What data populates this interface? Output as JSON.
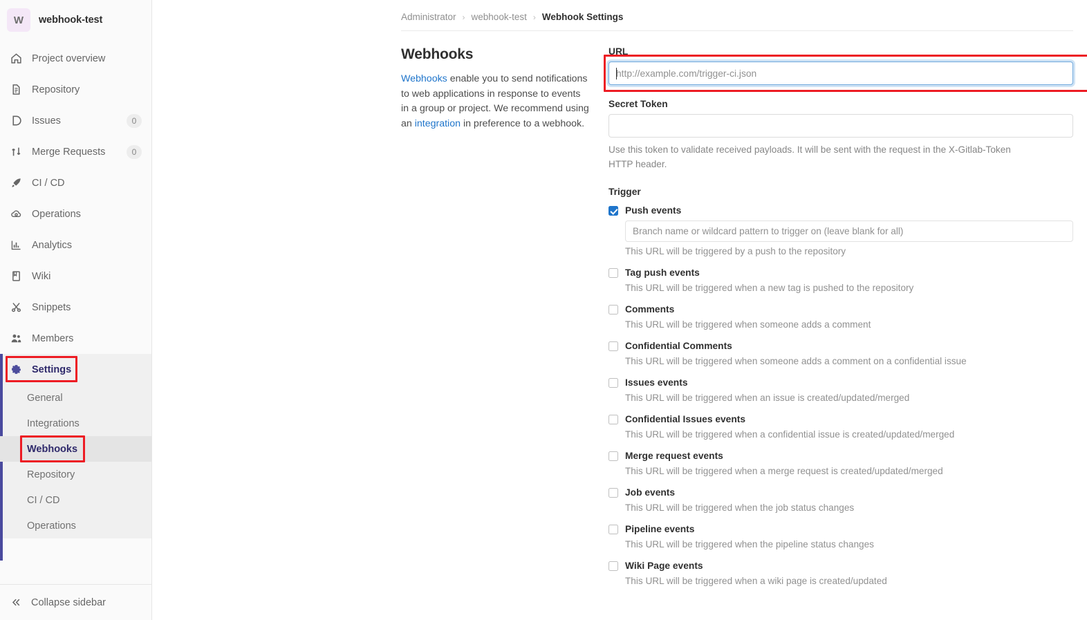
{
  "sidebar": {
    "project": {
      "avatar_letter": "W",
      "name": "webhook-test",
      "avatar_color": "#f4e7f7"
    },
    "items": [
      {
        "label": "Project overview",
        "icon": "home-icon",
        "badge": null
      },
      {
        "label": "Repository",
        "icon": "document-icon",
        "badge": null
      },
      {
        "label": "Issues",
        "icon": "issues-icon",
        "badge": "0"
      },
      {
        "label": "Merge Requests",
        "icon": "merge-request-icon",
        "badge": "0"
      },
      {
        "label": "CI / CD",
        "icon": "rocket-icon",
        "badge": null
      },
      {
        "label": "Operations",
        "icon": "cloud-gear-icon",
        "badge": null
      },
      {
        "label": "Analytics",
        "icon": "chart-icon",
        "badge": null
      },
      {
        "label": "Wiki",
        "icon": "book-icon",
        "badge": null
      },
      {
        "label": "Snippets",
        "icon": "scissors-icon",
        "badge": null
      },
      {
        "label": "Members",
        "icon": "users-icon",
        "badge": null
      },
      {
        "label": "Settings",
        "icon": "gear-icon",
        "badge": null,
        "active": true
      }
    ],
    "subitems": [
      {
        "label": "General"
      },
      {
        "label": "Integrations"
      },
      {
        "label": "Webhooks",
        "current": true
      },
      {
        "label": "Repository"
      },
      {
        "label": "CI / CD"
      },
      {
        "label": "Operations"
      }
    ],
    "collapse": {
      "label": "Collapse sidebar",
      "icon": "double-chevron-left-icon"
    },
    "active_color": "#2f2a6b",
    "rail_color": "#4a4a9e"
  },
  "breadcrumb": {
    "items": [
      "Administrator",
      "webhook-test",
      "Webhook Settings"
    ],
    "separator": "›"
  },
  "description": {
    "title": "Webhooks",
    "link1": "Webhooks",
    "text1": " enable you to send notifications to web applications in response to events in a group or project. We recommend using an ",
    "link2": "integration",
    "text2": " in preference to a webhook."
  },
  "form": {
    "url": {
      "label": "URL",
      "placeholder": "http://example.com/trigger-ci.json",
      "value": "",
      "focused": true,
      "highlight_color": "#ed1c24"
    },
    "secret_token": {
      "label": "Secret Token",
      "placeholder": "",
      "value": "",
      "help": "Use this token to validate received payloads. It will be sent with the request in the X-Gitlab-Token HTTP header."
    },
    "trigger_title": "Trigger",
    "triggers": [
      {
        "name": "Push events",
        "checked": true,
        "branch_input_placeholder": "Branch name or wildcard pattern to trigger on (leave blank for all)",
        "branch_input_value": "",
        "desc": "This URL will be triggered by a push to the repository"
      },
      {
        "name": "Tag push events",
        "checked": false,
        "desc": "This URL will be triggered when a new tag is pushed to the repository"
      },
      {
        "name": "Comments",
        "checked": false,
        "desc": "This URL will be triggered when someone adds a comment"
      },
      {
        "name": "Confidential Comments",
        "checked": false,
        "desc": "This URL will be triggered when someone adds a comment on a confidential issue"
      },
      {
        "name": "Issues events",
        "checked": false,
        "desc": "This URL will be triggered when an issue is created/updated/merged"
      },
      {
        "name": "Confidential Issues events",
        "checked": false,
        "desc": "This URL will be triggered when a confidential issue is created/updated/merged"
      },
      {
        "name": "Merge request events",
        "checked": false,
        "desc": "This URL will be triggered when a merge request is created/updated/merged"
      },
      {
        "name": "Job events",
        "checked": false,
        "desc": "This URL will be triggered when the job status changes"
      },
      {
        "name": "Pipeline events",
        "checked": false,
        "desc": "This URL will be triggered when the pipeline status changes"
      },
      {
        "name": "Wiki Page events",
        "checked": false,
        "desc": "This URL will be triggered when a wiki page is created/updated"
      }
    ]
  },
  "colors": {
    "link": "#1f75cb",
    "checkbox_checked": "#1f75cb",
    "annotation": "#ed1c24"
  }
}
